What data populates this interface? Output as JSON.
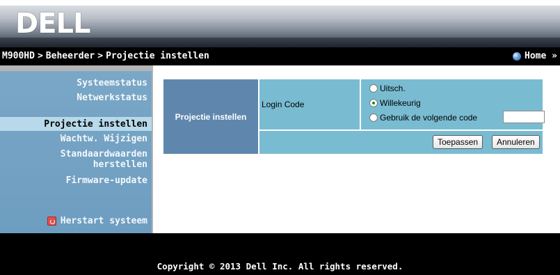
{
  "brand": {
    "logo_text": "DELL"
  },
  "breadcrumb": {
    "items": [
      "M900HD",
      "Beheerder",
      "Projectie instellen"
    ],
    "separator": ">",
    "home_label": "Home »"
  },
  "sidebar": {
    "items": [
      {
        "label": "Systeemstatus"
      },
      {
        "label": "Netwerkstatus"
      },
      {
        "label": "Projectie instellen",
        "active": true
      },
      {
        "label": "Wachtw. Wijzigen"
      },
      {
        "label": "Standaardwaarden herstellen"
      },
      {
        "label": "Firmware-update"
      }
    ],
    "restart_label": "Herstart systeem"
  },
  "form": {
    "section_title": "Projectie instellen",
    "field_label": "Login Code",
    "options": [
      {
        "label": "Uitsch.",
        "checked": false
      },
      {
        "label": "Willekeurig",
        "checked": true
      },
      {
        "label": "Gebruik de volgende code",
        "checked": false
      }
    ],
    "code_value": "",
    "apply_label": "Toepassen",
    "cancel_label": "Annuleren"
  },
  "footer": {
    "copyright": "Copyright © 2013 Dell Inc. All rights reserved."
  },
  "colors": {
    "sidebar_bg": "#6d9dc0",
    "sidebar_active": "#b7d9e9",
    "section_title_bg": "#5f87ad",
    "form_cell_bg": "#79bcd2",
    "restart_icon": "#e0504f"
  }
}
